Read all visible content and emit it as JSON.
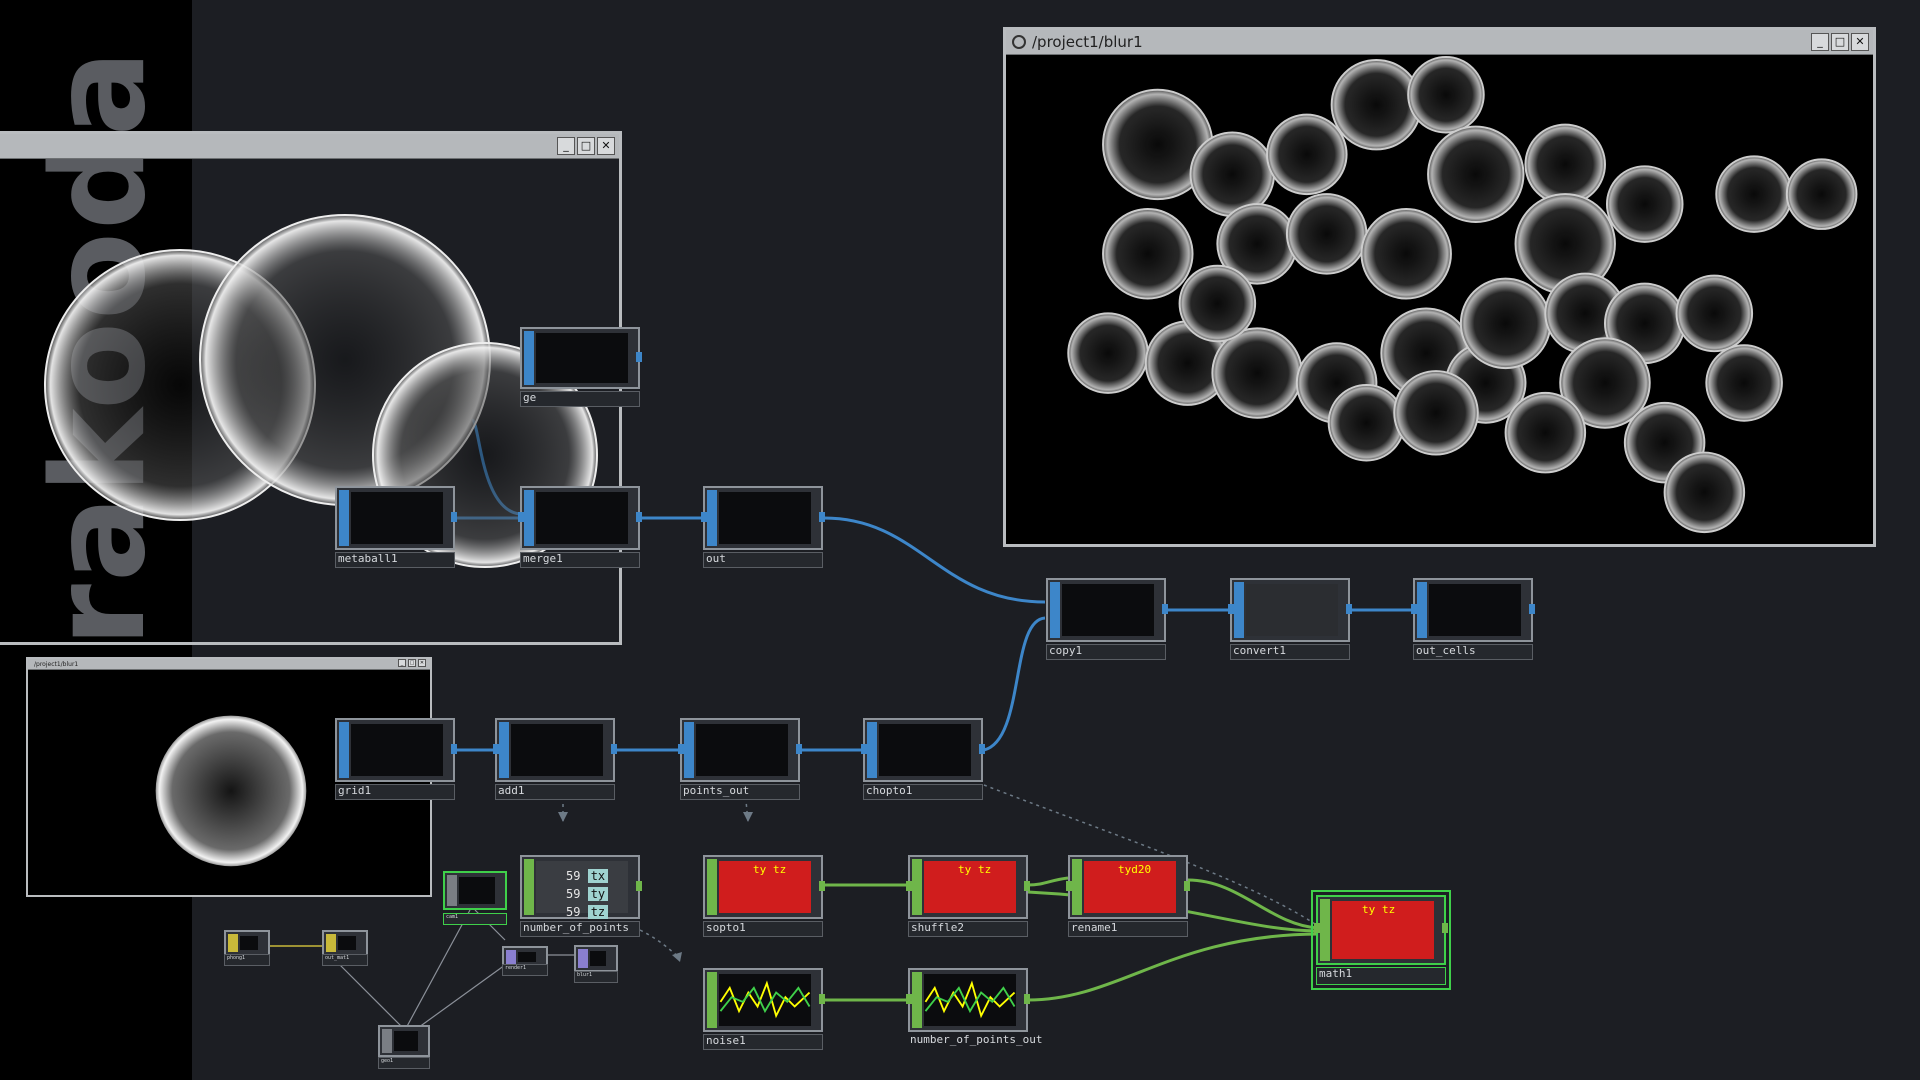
{
  "brand": {
    "text": "Barakooda"
  },
  "windows": {
    "main_viewer": {
      "title": "/project1/blur1",
      "minimize": "_",
      "maximize": "□",
      "close": "✕"
    },
    "left_viewer": {
      "title": "",
      "minimize": "_",
      "maximize": "□",
      "close": "✕"
    },
    "small_viewer": {
      "title": "/project1/blur1",
      "minimize": "_",
      "maximize": "□",
      "close": "✕"
    }
  },
  "nodes": {
    "metaball1": "metaball1",
    "merge1": "merge1",
    "out": "out",
    "geo_partial": "ge",
    "copy1": "copy1",
    "convert1": "convert1",
    "out_cells": "out_cells",
    "grid1": "grid1",
    "add1": "add1",
    "points_out": "points_out",
    "chopto1": "chopto1",
    "number_of_points": "number_of_points",
    "sopto1": "sopto1",
    "shuffle2": "shuffle2",
    "rename1": "rename1",
    "math1": "math1",
    "noise1": "noise1",
    "number_of_points_out": "number_of_points_out",
    "phong1": "phong1",
    "out_mat1": "out_mat1",
    "geo1": "geo1",
    "cam1": "cam1",
    "render1": "render1",
    "blur1": "blur1"
  },
  "channel_values": {
    "tx_val": "59",
    "ty_val": "59",
    "tz_val": "59",
    "tx": "tx",
    "ty": "ty",
    "tz": "tz"
  },
  "chop_labels": {
    "rename_chan": "tyd20",
    "ch_a": "ty",
    "ch_b": "tz",
    "ch_c": "tx"
  },
  "colors": {
    "sop_wire": "#3d86c9",
    "chop_wire": "#6fb64a",
    "selection": "#3fd04a",
    "background": "#1c1e23"
  }
}
